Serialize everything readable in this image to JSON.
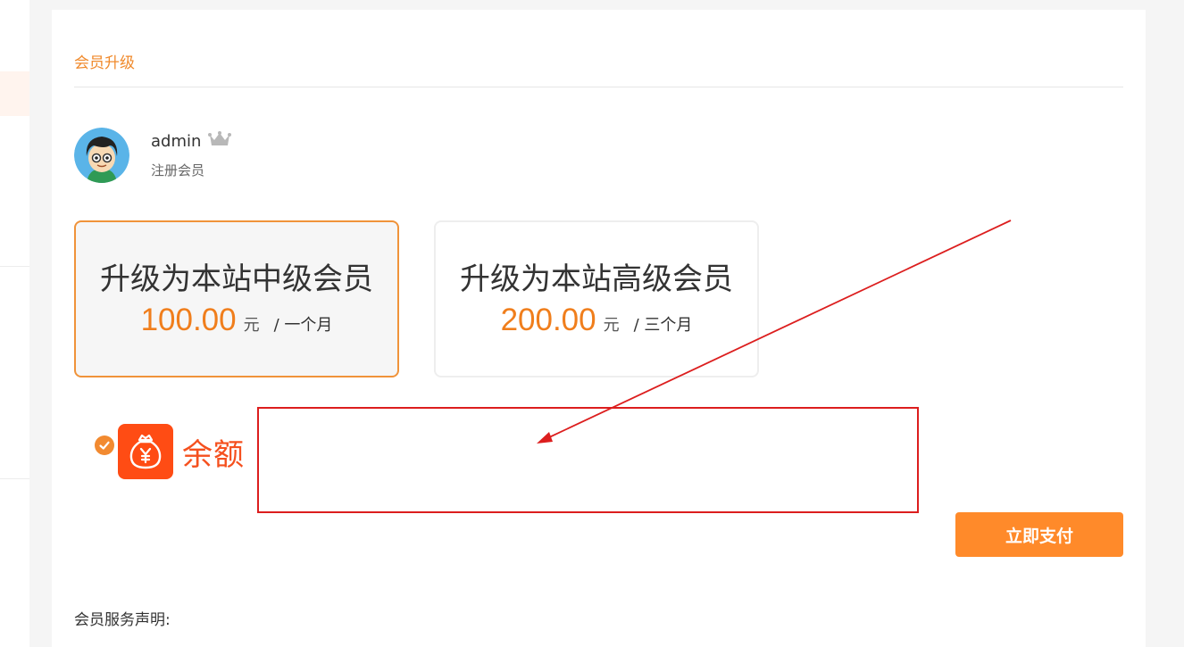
{
  "section_title": "会员升级",
  "user": {
    "name": "admin",
    "level": "注册会员"
  },
  "plans": [
    {
      "title": "升级为本站中级会员",
      "price": "100.00",
      "unit": "元",
      "period": "/ 一个月",
      "selected": true
    },
    {
      "title": "升级为本站高级会员",
      "price": "200.00",
      "unit": "元",
      "period": "/ 三个月",
      "selected": false
    }
  ],
  "payment": {
    "method_label": "余额",
    "icon": "money-bag-icon",
    "selected": true
  },
  "pay_button_label": "立即支付",
  "statement_label": "会员服务声明:",
  "colors": {
    "accent": "#f08a2c",
    "price": "#f07e1c",
    "pay_button": "#ff8a2a",
    "balance": "#ff4c14",
    "annotation": "#dc1e1e"
  }
}
